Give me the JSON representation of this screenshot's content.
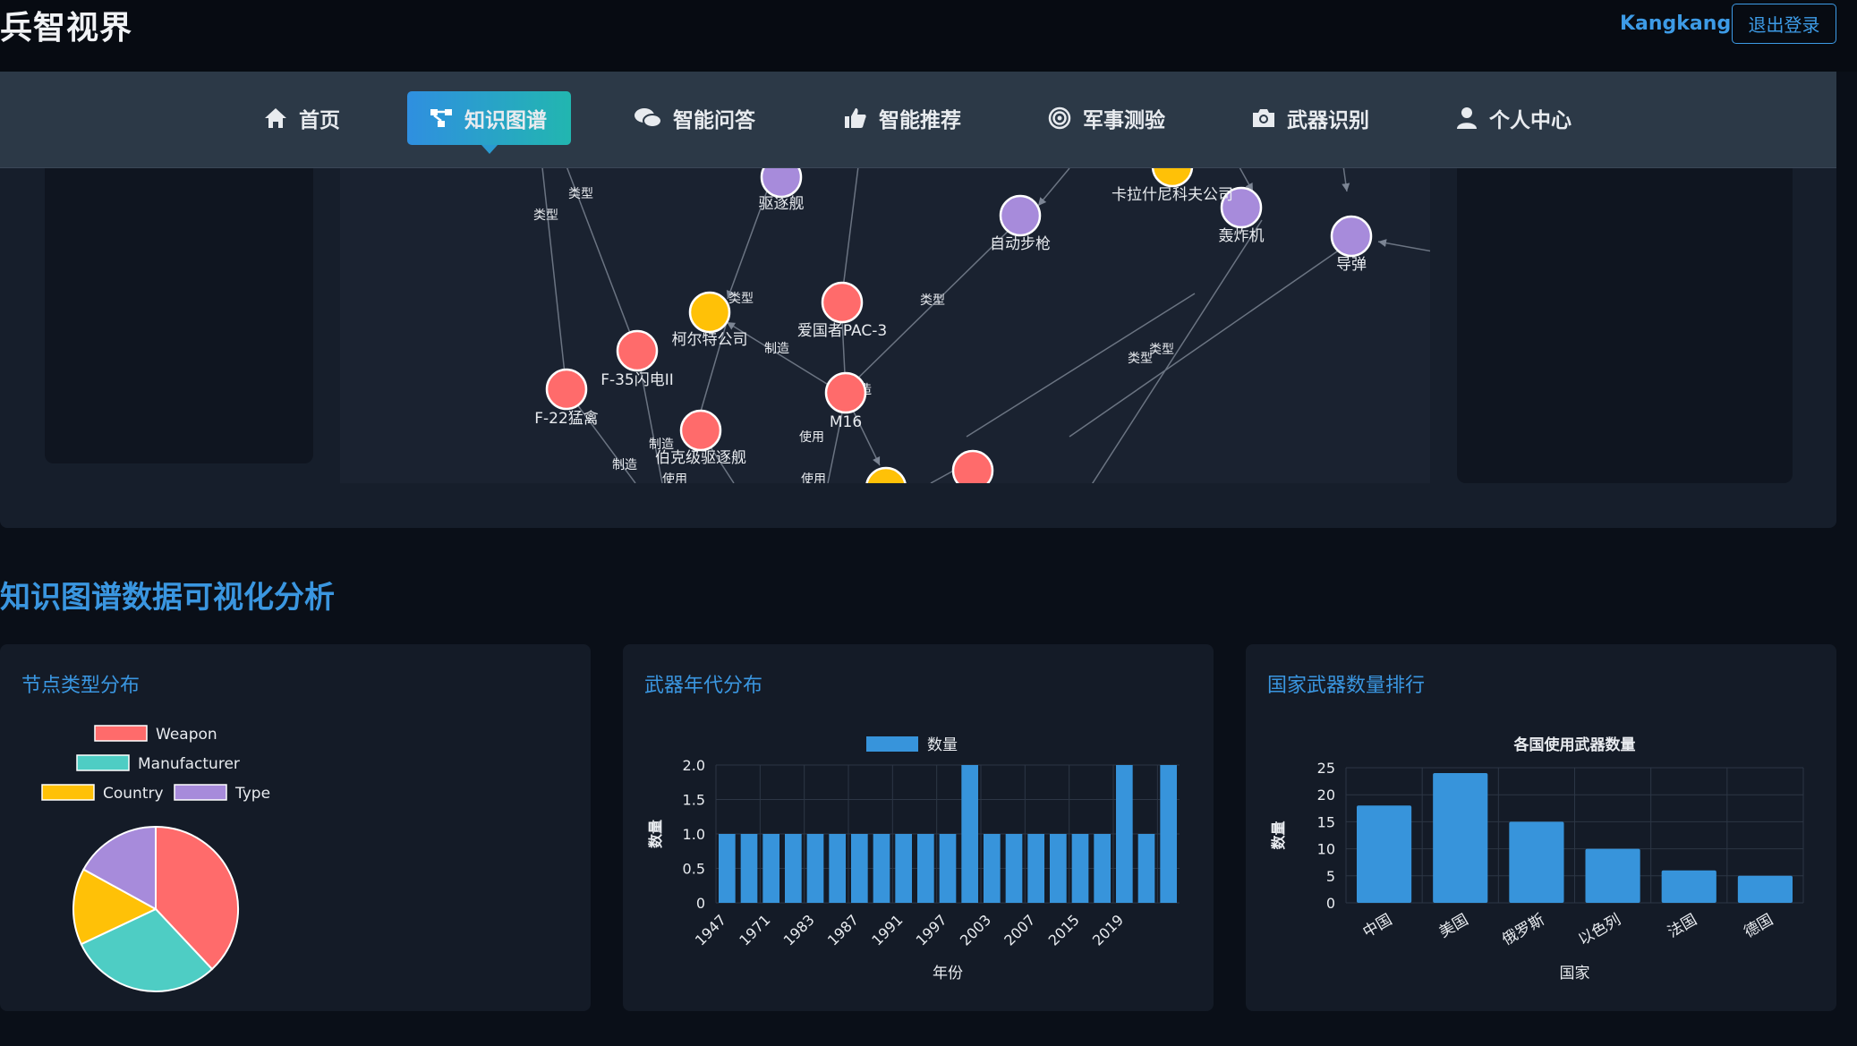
{
  "app": {
    "brand": "兵智视界",
    "user": "Kangkang",
    "logout_label": "退出登录"
  },
  "nav": {
    "items": [
      {
        "label": "首页",
        "icon": "home-icon"
      },
      {
        "label": "知识图谱",
        "icon": "graph-icon",
        "active": true
      },
      {
        "label": "智能问答",
        "icon": "chat-icon"
      },
      {
        "label": "智能推荐",
        "icon": "thumbs-up-icon"
      },
      {
        "label": "军事测验",
        "icon": "target-icon"
      },
      {
        "label": "武器识别",
        "icon": "camera-icon"
      },
      {
        "label": "个人中心",
        "icon": "user-icon"
      }
    ]
  },
  "graph": {
    "nodes": [
      {
        "label": "驱逐舰",
        "kind": "Type"
      },
      {
        "label": "自动步枪",
        "kind": "Type"
      },
      {
        "label": "卡拉什尼科夫公司",
        "kind": "Manufacturer"
      },
      {
        "label": "轰炸机",
        "kind": "Type"
      },
      {
        "label": "导弹",
        "kind": "Type"
      },
      {
        "label": "柯尔特公司",
        "kind": "Manufacturer"
      },
      {
        "label": "爱国者PAC-3",
        "kind": "Weapon"
      },
      {
        "label": "F-35闪电II",
        "kind": "Weapon"
      },
      {
        "label": "F-22猛禽",
        "kind": "Weapon"
      },
      {
        "label": "M16",
        "kind": "Weapon"
      },
      {
        "label": "伯克级驱逐舰",
        "kind": "Weapon"
      }
    ],
    "edge_labels": [
      "类型",
      "制造",
      "使用"
    ]
  },
  "colors": {
    "weapon": "#ff6b6b",
    "manufacturer": "#4ecdc4",
    "country": "#ffc107",
    "type": "#a78bdb",
    "accent": "#3a96e0",
    "bar": "#3794db"
  },
  "analysis": {
    "title": "知识图谱数据可视化分析",
    "cards": [
      {
        "title": "节点类型分布"
      },
      {
        "title": "武器年代分布"
      },
      {
        "title": "国家武器数量排行"
      }
    ]
  },
  "chart_data": [
    {
      "type": "pie",
      "title": "",
      "categories": [
        "Weapon",
        "Manufacturer",
        "Country",
        "Type"
      ],
      "values": [
        38,
        30,
        15,
        17
      ],
      "legend": "top"
    },
    {
      "type": "bar",
      "title": "",
      "legend": [
        "数量"
      ],
      "xlabel": "年份",
      "ylabel": "数量",
      "ylim": [
        0,
        2.0
      ],
      "yticks": [
        "0",
        "0.5",
        "1.0",
        "1.5",
        "2.0"
      ],
      "xtick_labels": [
        "1947",
        "1971",
        "1983",
        "1987",
        "1991",
        "1997",
        "2003",
        "2007",
        "2015",
        "2019"
      ],
      "values": [
        1,
        1,
        1,
        1,
        1,
        1,
        1,
        1,
        1,
        1,
        1,
        2,
        1,
        1,
        1,
        1,
        1,
        1,
        2,
        1,
        2
      ]
    },
    {
      "type": "bar",
      "title": "各国使用武器数量",
      "xlabel": "国家",
      "ylabel": "数量",
      "ylim": [
        0,
        25
      ],
      "yticks": [
        "0",
        "5",
        "10",
        "15",
        "20",
        "25"
      ],
      "categories": [
        "中国",
        "美国",
        "俄罗斯",
        "以色列",
        "法国",
        "德国"
      ],
      "values": [
        18,
        24,
        15,
        10,
        6,
        5
      ]
    }
  ]
}
